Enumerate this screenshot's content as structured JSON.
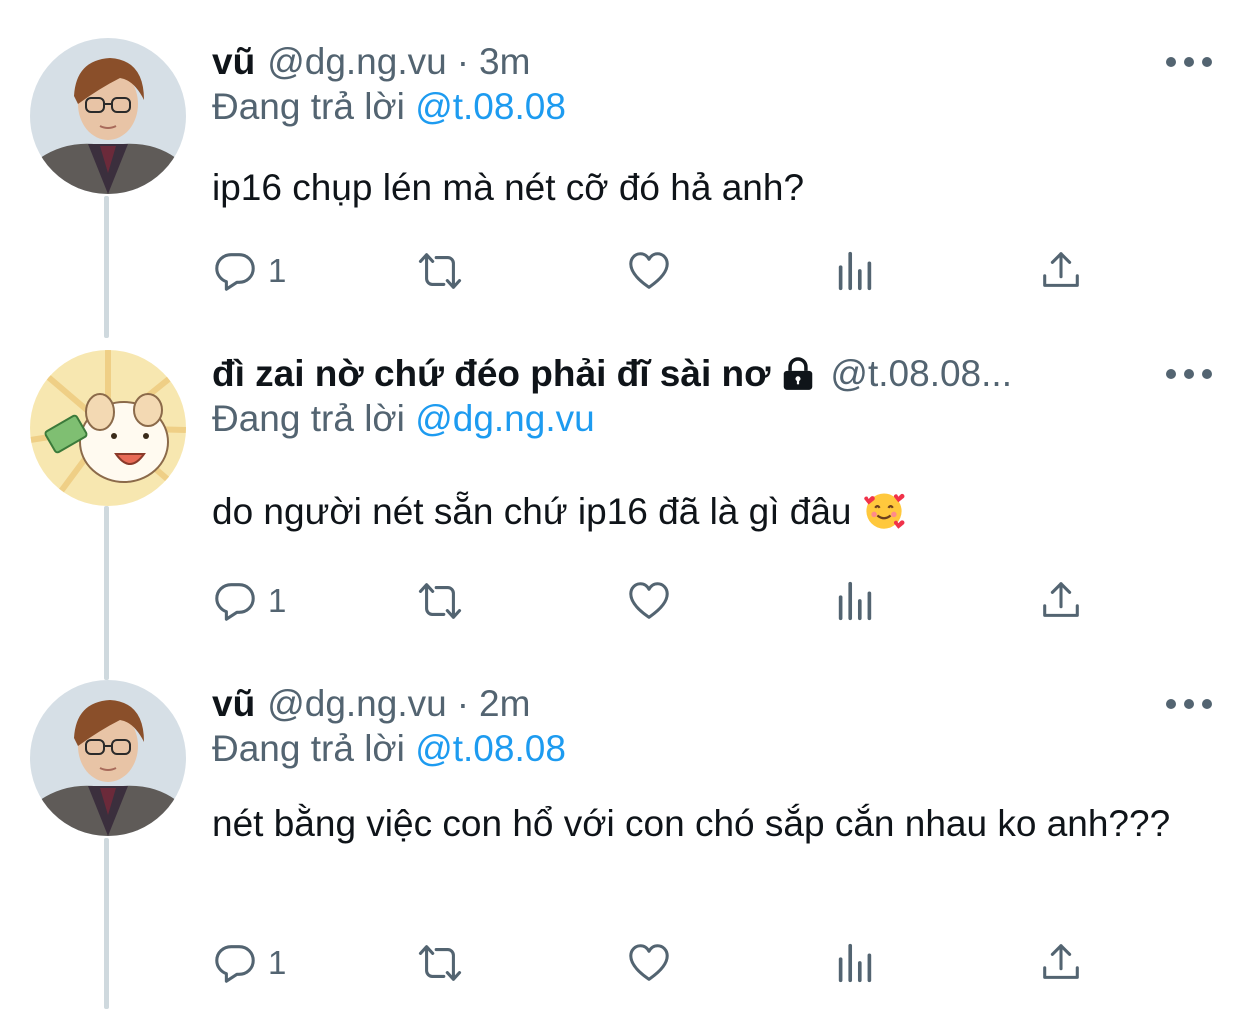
{
  "tweets": [
    {
      "name": "vũ",
      "handle": "@dg.ng.vu",
      "sep": "·",
      "time": "3m",
      "reply_prefix": "Đang trả lời",
      "reply_to": "@t.08.08",
      "text": "ip16 chụp lén mà nét cỡ đó hả anh?",
      "reply_count": "1",
      "avatar_icon": "person-avatar"
    },
    {
      "name": "đì zai nờ chứ đéo phải đĩ sài nơ",
      "handle": "@t.08.08...",
      "protected_icon": "lock-icon",
      "reply_prefix": "Đang trả lời",
      "reply_to": "@dg.ng.vu",
      "text": "do người nét sẵn chứ ip16 đã là gì đâu",
      "emoji": "smiling-face-with-hearts",
      "reply_count": "1",
      "avatar_icon": "cartoon-dog-avatar"
    },
    {
      "name": "vũ",
      "handle": "@dg.ng.vu",
      "sep": "·",
      "time": "2m",
      "reply_prefix": "Đang trả lời",
      "reply_to": "@t.08.08",
      "text": "nét bằng việc con hổ với con chó sắp cắn nhau ko anh???",
      "reply_count": "1",
      "avatar_icon": "person-avatar"
    }
  ],
  "colors": {
    "link": "#1d9bf0",
    "secondary": "#536471",
    "thread_line": "#cfd9de"
  }
}
